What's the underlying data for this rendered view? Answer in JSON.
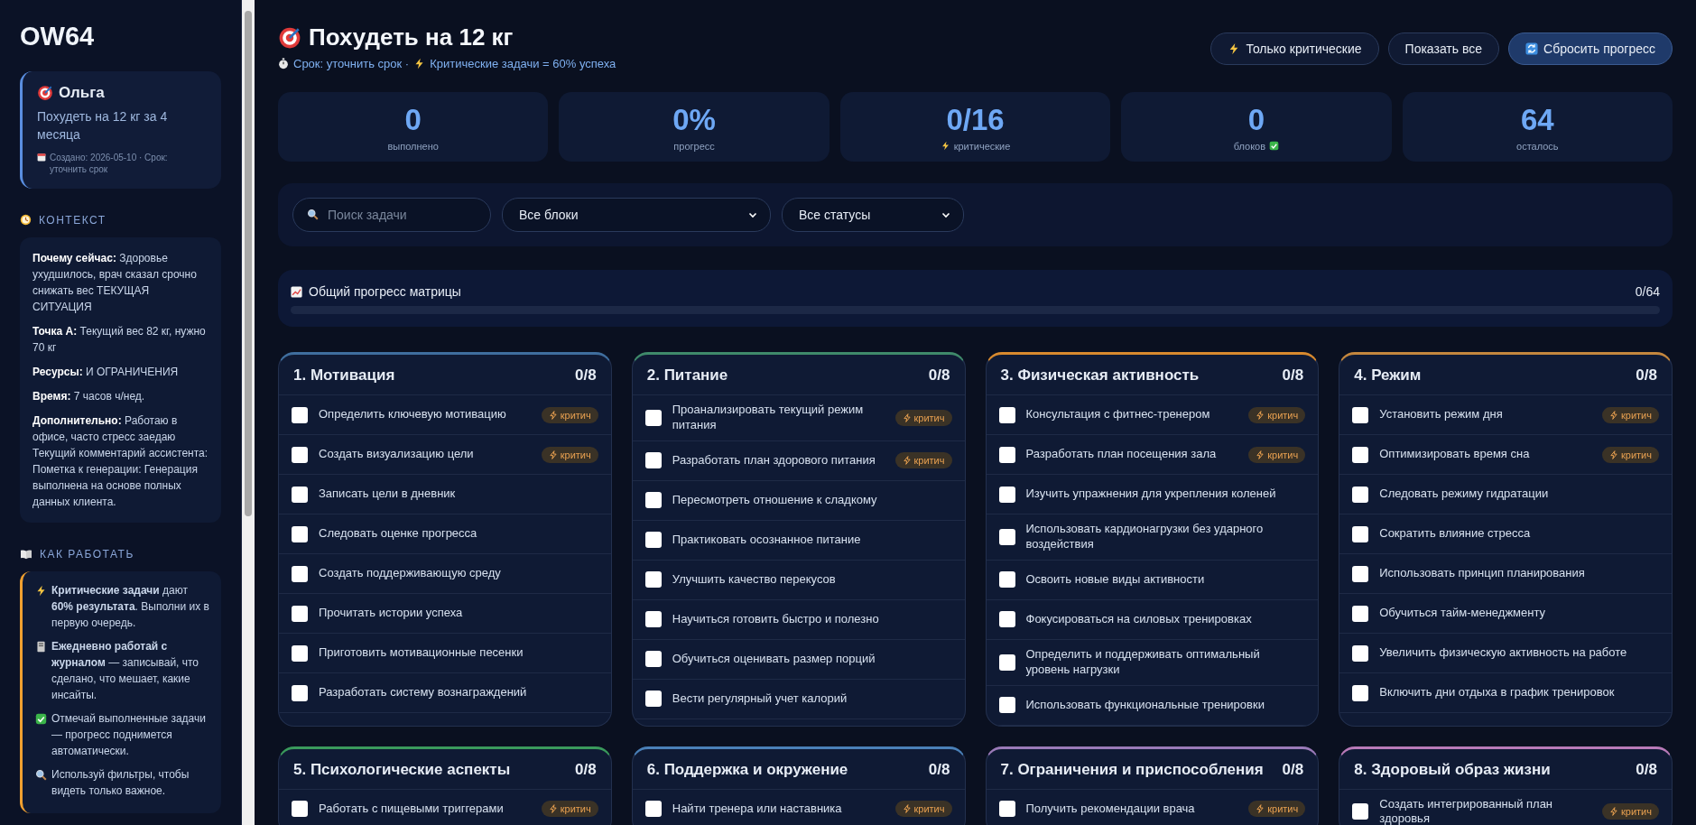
{
  "sidebar": {
    "logo": "OW64",
    "profile": {
      "name": "Ольга",
      "goal": "Похудеть на 12 кг за 4 месяца",
      "meta": "Создано: 2026-05-10 · Срок: уточнить срок"
    },
    "context": {
      "heading": "КОНТЕКСТ",
      "items": [
        {
          "label": "Почему сейчас:",
          "text": "Здоровье ухудшилось, врач сказал срочно снижать вес ТЕКУЩАЯ СИТУАЦИЯ"
        },
        {
          "label": "Точка А:",
          "text": "Текущий вес 82 кг, нужно 70 кг"
        },
        {
          "label": "Ресурсы:",
          "text": "И ОГРАНИЧЕНИЯ"
        },
        {
          "label": "Время:",
          "text": "7 часов ч/нед."
        },
        {
          "label": "Дополнительно:",
          "text": "Работаю в офисе, часто стресс заедаю Текущий комментарий ассистента: Пометка к генерации: Генерация выполнена на основе полных данных клиента."
        }
      ]
    },
    "howto": {
      "heading": "КАК РАБОТАТЬ",
      "items": [
        {
          "text": "**Критические задачи** дают **60% результата**. Выполни их в первую очередь."
        },
        {
          "text": "**Ежедневно работай с журналом** — записывай, что сделано, что мешает, какие инсайты."
        },
        {
          "text": "Отмечай выполненные задачи — прогресс поднимется автоматически."
        },
        {
          "text": "Используй фильтры, чтобы видеть только важное."
        }
      ]
    }
  },
  "header": {
    "title": "Похудеть на 12 кг",
    "deadline": "Срок: уточнить срок ·",
    "note": "Критические задачи = 60% успеха",
    "buttons": [
      {
        "label": "Только критические",
        "kind": "secondary"
      },
      {
        "label": "Показать все",
        "kind": "secondary"
      },
      {
        "label": "Сбросить прогресс",
        "kind": "primary"
      }
    ]
  },
  "stats": [
    {
      "value": "0",
      "label": "выполнено"
    },
    {
      "value": "0%",
      "label": "прогресс"
    },
    {
      "value": "0/16",
      "label": "критические"
    },
    {
      "value": "0",
      "label": "блоков"
    },
    {
      "value": "64",
      "label": "осталось"
    }
  ],
  "filters": {
    "search": {
      "placeholder": "Поиск задачи"
    },
    "block_select": "Все блоки",
    "status_select": "Все статусы"
  },
  "overall_progress": {
    "label": "Общий прогресс матрицы",
    "reading": "0/64",
    "level": 0
  },
  "blocks": [
    {
      "title": "1. Мотивация",
      "count": "0/8",
      "color": "#3f6e9e",
      "tasks": [
        {
          "text": "Определить ключевую мотивацию",
          "checked": false,
          "badge": "критич"
        },
        {
          "text": "Создать визуализацию цели",
          "checked": false,
          "badge": "критич"
        },
        {
          "text": "Записать цели в дневник",
          "checked": false
        },
        {
          "text": "Следовать оценке прогресса",
          "checked": false
        },
        {
          "text": "Создать поддерживающую среду",
          "checked": false
        },
        {
          "text": "Прочитать истории успеха",
          "checked": false
        },
        {
          "text": "Приготовить мотивационные песенки",
          "checked": false
        },
        {
          "text": "Разработать систему вознаграждений",
          "checked": false
        }
      ]
    },
    {
      "title": "2. Питание",
      "count": "0/8",
      "color": "#3f8a6a",
      "tasks": [
        {
          "text": "Проанализировать текущий режим питания",
          "checked": false,
          "badge": "критич"
        },
        {
          "text": "Разработать план здорового питания",
          "checked": false,
          "badge": "критич"
        },
        {
          "text": "Пересмотреть отношение к сладкому",
          "checked": false
        },
        {
          "text": "Практиковать осознанное питание",
          "checked": false
        },
        {
          "text": "Улучшить качество перекусов",
          "checked": false
        },
        {
          "text": "Научиться готовить быстро и полезно",
          "checked": false
        },
        {
          "text": "Обучиться оценивать размер порций",
          "checked": false
        },
        {
          "text": "Вести регулярный учет калорий",
          "checked": false
        }
      ]
    },
    {
      "title": "3. Физическая активность",
      "count": "0/8",
      "color": "#d88a2e",
      "tasks": [
        {
          "text": "Консультация с фитнес-тренером",
          "checked": false,
          "badge": "критич"
        },
        {
          "text": "Разработать план посещения зала",
          "checked": false,
          "badge": "критич"
        },
        {
          "text": "Изучить упражнения для укрепления коленей",
          "checked": false
        },
        {
          "text": "Использовать кардионагрузки без ударного воздействия",
          "checked": false
        },
        {
          "text": "Освоить новые виды активности",
          "checked": false
        },
        {
          "text": "Фокусироваться на силовых тренировках",
          "checked": false
        },
        {
          "text": "Определить и поддерживать оптимальный уровень нагрузки",
          "checked": false
        },
        {
          "text": "Использовать функциональные тренировки",
          "checked": false
        }
      ]
    },
    {
      "title": "4. Режим",
      "count": "0/8",
      "color": "#c4873e",
      "tasks": [
        {
          "text": "Установить режим дня",
          "checked": false,
          "badge": "критич"
        },
        {
          "text": "Оптимизировать время сна",
          "checked": false,
          "badge": "критич"
        },
        {
          "text": "Следовать режиму гидратации",
          "checked": false
        },
        {
          "text": "Сократить влияние стресса",
          "checked": false
        },
        {
          "text": "Использовать принцип планирования",
          "checked": false
        },
        {
          "text": "Обучиться тайм-менеджменту",
          "checked": false
        },
        {
          "text": "Увеличить физическую активность на работе",
          "checked": false
        },
        {
          "text": "Включить дни отдыха в график тренировок",
          "checked": false
        }
      ]
    },
    {
      "title": "5. Психологические аспекты",
      "count": "0/8",
      "color": "#3a9a5c",
      "tasks": [
        {
          "text": "Работать с пищевыми триггерами",
          "checked": false,
          "badge": "критич"
        }
      ]
    },
    {
      "title": "6. Поддержка и окружение",
      "count": "0/8",
      "color": "#4a80b8",
      "tasks": [
        {
          "text": "Найти тренера или наставника",
          "checked": false,
          "badge": "критич"
        }
      ]
    },
    {
      "title": "7. Ограничения и приспособления",
      "count": "0/8",
      "color": "#9a7ab8",
      "tasks": [
        {
          "text": "Получить рекомендации врача",
          "checked": false,
          "badge": "критич"
        }
      ]
    },
    {
      "title": "8. Здоровый образ жизни",
      "count": "0/8",
      "color": "#b87ab8",
      "tasks": [
        {
          "text": "Создать интегрированный план здоровья",
          "checked": false,
          "badge": "критич"
        }
      ]
    }
  ]
}
